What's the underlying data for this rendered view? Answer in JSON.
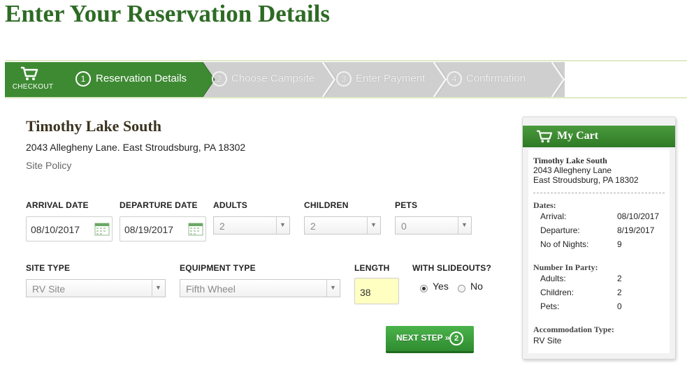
{
  "page": {
    "title": "Enter Your Reservation Details"
  },
  "steps": {
    "checkout_label": "CHECKOUT",
    "items": [
      {
        "number": "1",
        "label": "Reservation Details"
      },
      {
        "number": "2",
        "label": "Choose Campsite"
      },
      {
        "number": "3",
        "label": "Enter Payment"
      },
      {
        "number": "4",
        "label": "Confirmation"
      }
    ]
  },
  "campground": {
    "name": "Timothy Lake South",
    "address": "2043 Allegheny Lane. East Stroudsburg, PA 18302",
    "site_policy_link": "Site Policy"
  },
  "form": {
    "arrival_label": "ARRIVAL DATE",
    "arrival_value": "08/10/2017",
    "departure_label": "DEPARTURE DATE",
    "departure_value": "08/19/2017",
    "adults_label": "ADULTS",
    "adults_value": "2",
    "children_label": "CHILDREN",
    "children_value": "2",
    "pets_label": "PETS",
    "pets_value": "0",
    "site_type_label": "SITE TYPE",
    "site_type_value": "RV Site",
    "equipment_type_label": "EQUIPMENT TYPE",
    "equipment_type_value": "Fifth Wheel",
    "length_label": "LENGTH",
    "length_value": "38",
    "slideouts_label": "WITH SLIDEOUTS?",
    "slideouts_yes": "Yes",
    "slideouts_no": "No",
    "slideouts_selected": "Yes",
    "next_button": "NEXT STEP »",
    "next_button_step": "2"
  },
  "cart": {
    "title": "My Cart",
    "name": "Timothy Lake South",
    "address_line1": "2043 Allegheny Lane",
    "address_line2": "East Stroudsburg, PA 18302",
    "dates_heading": "Dates:",
    "arrival_label": "Arrival:",
    "arrival_value": "08/10/2017",
    "departure_label": "Departure:",
    "departure_value": "8/19/2017",
    "nights_label": "No of Nights:",
    "nights_value": "9",
    "party_heading": "Number In Party:",
    "adults_label": "Adults:",
    "adults_value": "2",
    "children_label": "Children:",
    "children_value": "2",
    "pets_label": "Pets:",
    "pets_value": "0",
    "accommodation_heading": "Accommodation Type:",
    "accommodation_value": "RV Site"
  },
  "colors": {
    "title_green": "#2e6b25",
    "step_active": "#3e8a33",
    "step_inactive": "#cfcfcf",
    "length_highlight": "#ffffc2",
    "button_green": "#3aa23a"
  },
  "icons": [
    "cart-icon",
    "calendar-icon",
    "chevron-down-icon"
  ]
}
